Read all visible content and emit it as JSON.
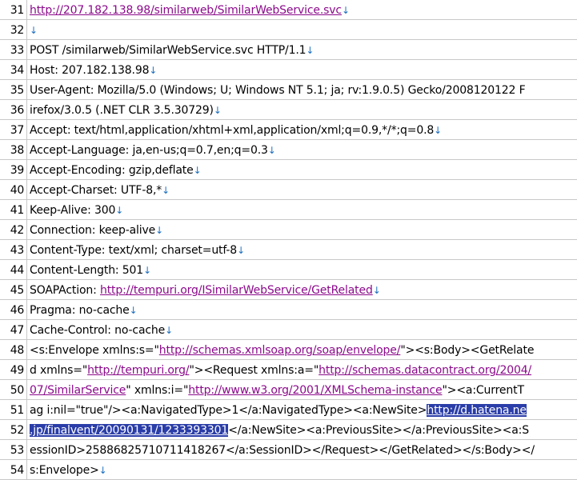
{
  "editor": {
    "return_mark": "↓",
    "lines": [
      {
        "num": "31",
        "parts": [
          {
            "t": "http://207.182.138.98/similarweb/SimilarWebService.svc",
            "k": "url"
          }
        ],
        "ret": true
      },
      {
        "num": "32",
        "parts": [],
        "ret": true
      },
      {
        "num": "33",
        "parts": [
          {
            "t": "POST /similarweb/SimilarWebService.svc HTTP/1.1",
            "k": "txt"
          }
        ],
        "ret": true
      },
      {
        "num": "34",
        "parts": [
          {
            "t": "Host: 207.182.138.98",
            "k": "txt"
          }
        ],
        "ret": true
      },
      {
        "num": "35",
        "parts": [
          {
            "t": "User-Agent: Mozilla/5.0 (Windows; U; Windows NT 5.1; ja; rv:1.9.0.5) Gecko/2008120122 F",
            "k": "txt"
          }
        ],
        "ret": false
      },
      {
        "num": "36",
        "parts": [
          {
            "t": "irefox/3.0.5 (.NET CLR 3.5.30729)",
            "k": "txt"
          }
        ],
        "ret": true
      },
      {
        "num": "37",
        "parts": [
          {
            "t": "Accept: text/html,application/xhtml+xml,application/xml;q=0.9,*/*;q=0.8",
            "k": "txt"
          }
        ],
        "ret": true
      },
      {
        "num": "38",
        "parts": [
          {
            "t": "Accept-Language: ja,en-us;q=0.7,en;q=0.3",
            "k": "txt"
          }
        ],
        "ret": true
      },
      {
        "num": "39",
        "parts": [
          {
            "t": "Accept-Encoding: gzip,deflate",
            "k": "txt"
          }
        ],
        "ret": true
      },
      {
        "num": "40",
        "parts": [
          {
            "t": "Accept-Charset: UTF-8,*",
            "k": "txt"
          }
        ],
        "ret": true
      },
      {
        "num": "41",
        "parts": [
          {
            "t": "Keep-Alive: 300",
            "k": "txt"
          }
        ],
        "ret": true
      },
      {
        "num": "42",
        "parts": [
          {
            "t": "Connection: keep-alive",
            "k": "txt"
          }
        ],
        "ret": true
      },
      {
        "num": "43",
        "parts": [
          {
            "t": "Content-Type: text/xml; charset=utf-8",
            "k": "txt"
          }
        ],
        "ret": true
      },
      {
        "num": "44",
        "parts": [
          {
            "t": "Content-Length: 501",
            "k": "txt"
          }
        ],
        "ret": true
      },
      {
        "num": "45",
        "parts": [
          {
            "t": "SOAPAction: ",
            "k": "txt"
          },
          {
            "t": "http://tempuri.org/ISimilarWebService/GetRelated",
            "k": "url"
          }
        ],
        "ret": true
      },
      {
        "num": "46",
        "parts": [
          {
            "t": "Pragma: no-cache",
            "k": "txt"
          }
        ],
        "ret": true
      },
      {
        "num": "47",
        "parts": [
          {
            "t": "Cache-Control: no-cache",
            "k": "txt"
          }
        ],
        "ret": true
      },
      {
        "num": "48",
        "parts": [
          {
            "t": "<s:Envelope xmlns:s=\"",
            "k": "txt"
          },
          {
            "t": "http://schemas.xmlsoap.org/soap/envelope/",
            "k": "url"
          },
          {
            "t": "\"><s:Body><GetRelate",
            "k": "txt"
          }
        ],
        "ret": false
      },
      {
        "num": "49",
        "parts": [
          {
            "t": "d xmlns=\"",
            "k": "txt"
          },
          {
            "t": "http://tempuri.org/",
            "k": "url"
          },
          {
            "t": "\"><Request xmlns:a=\"",
            "k": "txt"
          },
          {
            "t": "http://schemas.datacontract.org/2004/",
            "k": "url"
          }
        ],
        "ret": false
      },
      {
        "num": "50",
        "parts": [
          {
            "t": "07/SimilarService",
            "k": "url"
          },
          {
            "t": "\" xmlns:i=\"",
            "k": "txt"
          },
          {
            "t": "http://www.w3.org/2001/XMLSchema-instance",
            "k": "url"
          },
          {
            "t": "\"><a:CurrentT",
            "k": "txt"
          }
        ],
        "ret": false
      },
      {
        "num": "51",
        "parts": [
          {
            "t": "ag i:nil=\"true\"/><a:NavigatedType>1</a:NavigatedType><a:NewSite>",
            "k": "txt"
          },
          {
            "t": "http://d.hatena.ne",
            "k": "sel"
          }
        ],
        "ret": false
      },
      {
        "num": "52",
        "parts": [
          {
            "t": ".jp/finalvent/20090131/1233393301",
            "k": "sel"
          },
          {
            "t": "</a:NewSite><a:PreviousSite></a:PreviousSite><a:S",
            "k": "txt"
          }
        ],
        "ret": false
      },
      {
        "num": "53",
        "parts": [
          {
            "t": "essionID>25886825710711418267</a:SessionID></Request></GetRelated></s:Body></",
            "k": "txt"
          }
        ],
        "ret": false
      },
      {
        "num": "54",
        "parts": [
          {
            "t": "s:Envelope>",
            "k": "txt"
          }
        ],
        "ret": true
      }
    ]
  }
}
